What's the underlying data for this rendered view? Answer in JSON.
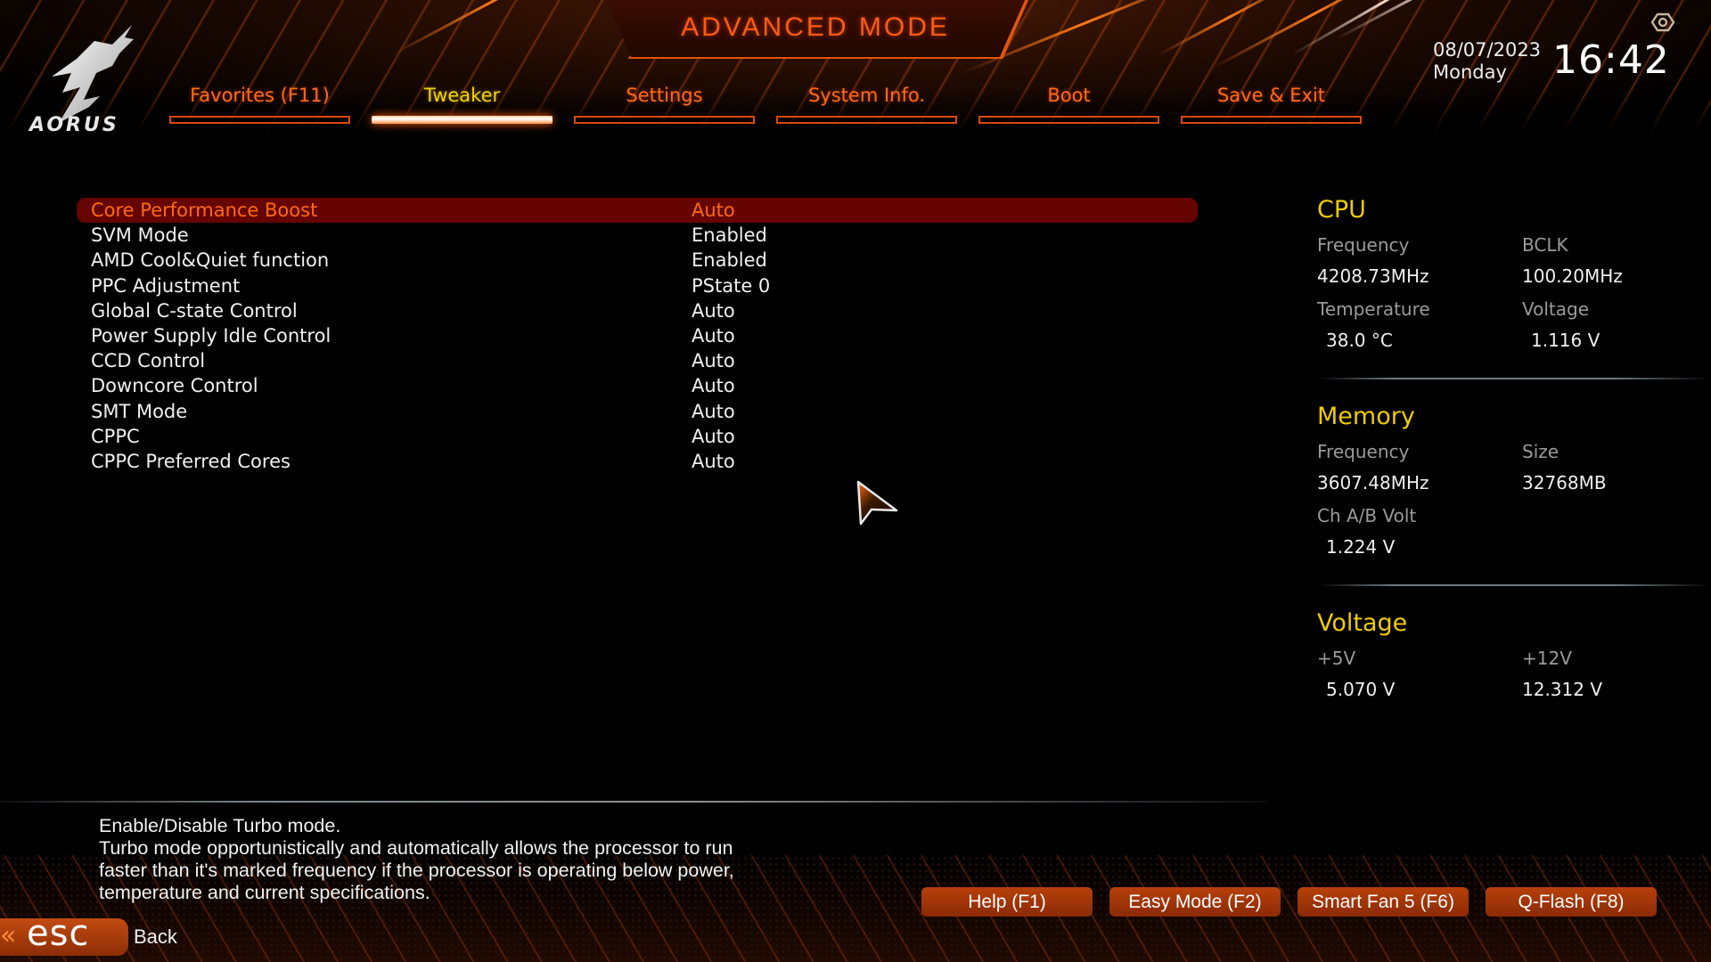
{
  "header": {
    "title": "ADVANCED MODE",
    "logo_text": "AORUS",
    "date": "08/07/2023",
    "day": "Monday",
    "time": "16:42"
  },
  "tabs": [
    {
      "label": "Favorites (F11)",
      "active": false
    },
    {
      "label": "Tweaker",
      "active": true
    },
    {
      "label": "Settings",
      "active": false
    },
    {
      "label": "System Info.",
      "active": false
    },
    {
      "label": "Boot",
      "active": false
    },
    {
      "label": "Save & Exit",
      "active": false
    }
  ],
  "settings": [
    {
      "label": "Core Performance Boost",
      "value": "Auto",
      "selected": true
    },
    {
      "label": "SVM Mode",
      "value": "Enabled"
    },
    {
      "label": "AMD Cool&Quiet function",
      "value": "Enabled"
    },
    {
      "label": "PPC Adjustment",
      "value": "PState 0"
    },
    {
      "label": "Global C-state Control",
      "value": "Auto"
    },
    {
      "label": "Power Supply Idle Control",
      "value": "Auto"
    },
    {
      "label": "CCD Control",
      "value": "Auto"
    },
    {
      "label": "Downcore Control",
      "value": "Auto"
    },
    {
      "label": "SMT Mode",
      "value": "Auto"
    },
    {
      "label": "CPPC",
      "value": "Auto"
    },
    {
      "label": "CPPC Preferred Cores",
      "value": "Auto"
    }
  ],
  "info": {
    "cpu": {
      "title": "CPU",
      "frequency_label": "Frequency",
      "frequency": "4208.73MHz",
      "bclk_label": "BCLK",
      "bclk": "100.20MHz",
      "temperature_label": "Temperature",
      "temperature": "38.0 °C",
      "voltage_label": "Voltage",
      "voltage": "1.116 V"
    },
    "memory": {
      "title": "Memory",
      "frequency_label": "Frequency",
      "frequency": "3607.48MHz",
      "size_label": "Size",
      "size": "32768MB",
      "volt_label": "Ch A/B Volt",
      "volt": "1.224 V"
    },
    "voltage": {
      "title": "Voltage",
      "v5_label": "+5V",
      "v5": "5.070 V",
      "v12_label": "+12V",
      "v12": "12.312 V"
    }
  },
  "description": {
    "line1": "Enable/Disable Turbo mode.",
    "line2": "Turbo mode opportunistically and automatically allows the processor to run",
    "line3": "faster than it's marked frequency if the processor is operating below power,",
    "line4": "temperature and current specifications."
  },
  "footer": {
    "esc_label": "esc",
    "back_label": "Back",
    "buttons": [
      "Help (F1)",
      "Easy Mode (F2)",
      "Smart Fan 5 (F6)",
      "Q-Flash (F8)"
    ]
  },
  "colors": {
    "accent_orange": "#ff6a14",
    "active_yellow": "#f5d400",
    "selection_bg": "#650400",
    "section_title": "#f0cc00"
  }
}
